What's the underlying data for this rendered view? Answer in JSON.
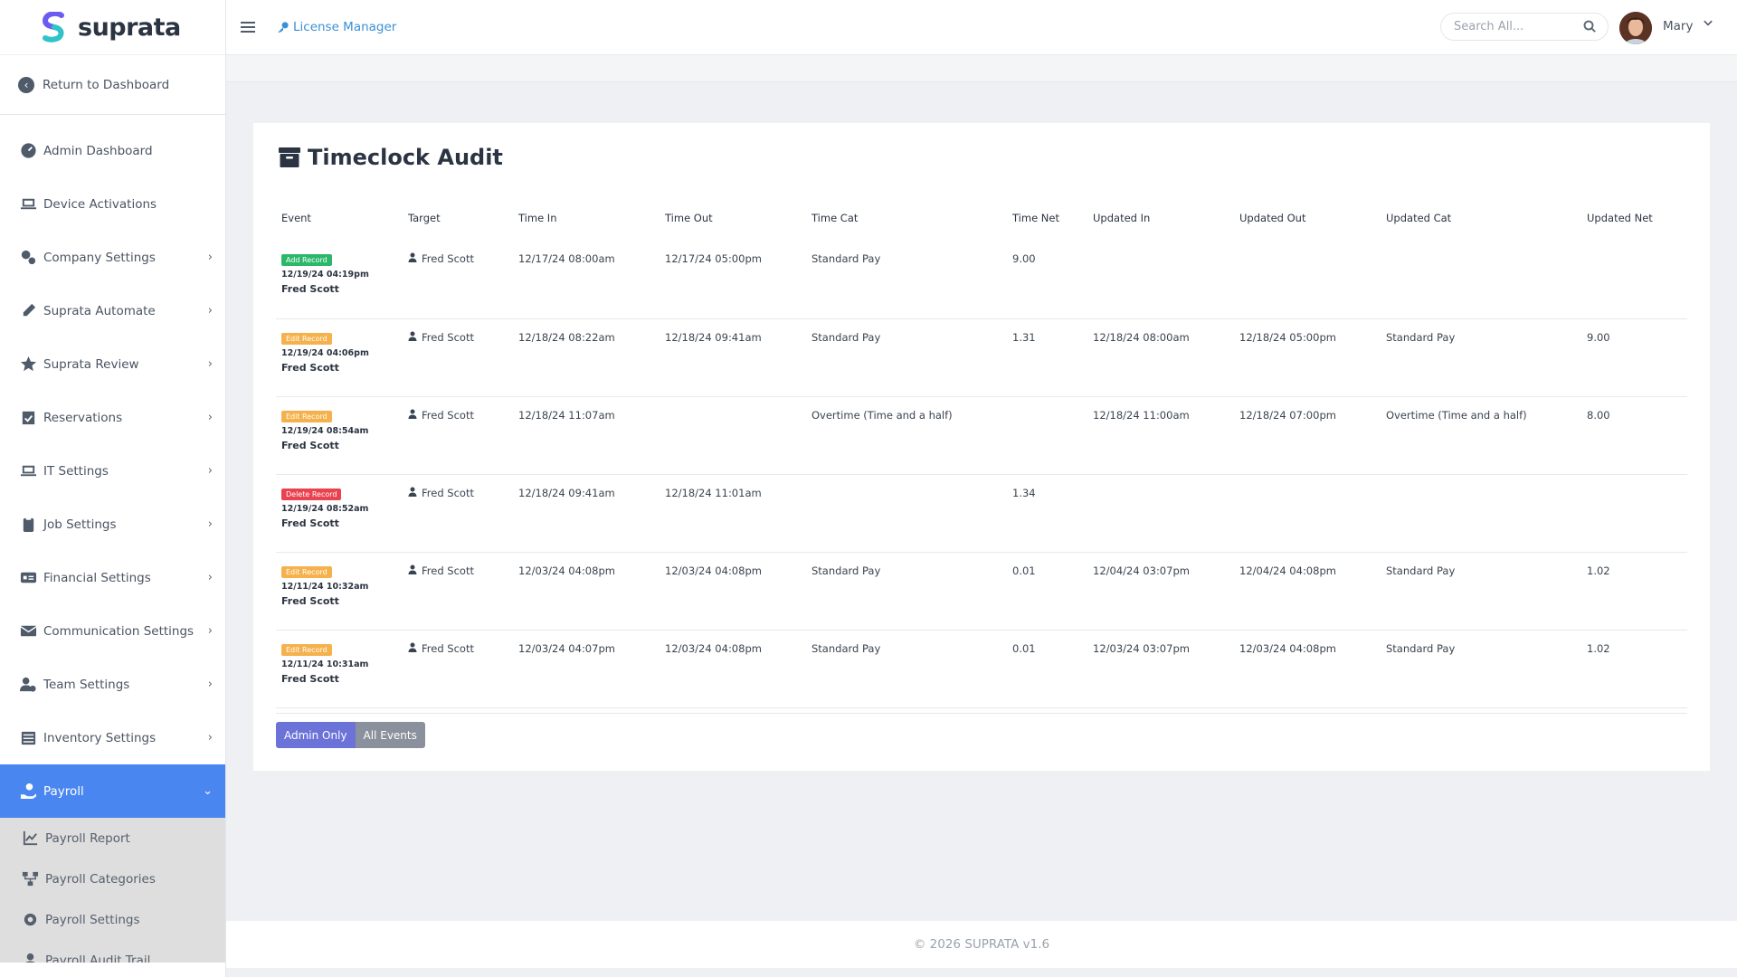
{
  "brand": {
    "name": "suprata"
  },
  "sidebar": {
    "return_label": "Return to Dashboard",
    "items": [
      {
        "label": "Admin Dashboard",
        "icon": "gauge-icon",
        "chevron": false
      },
      {
        "label": "Device Activations",
        "icon": "laptop-icon",
        "chevron": false
      },
      {
        "label": "Company Settings",
        "icon": "gears-icon",
        "chevron": true
      },
      {
        "label": "Suprata Automate",
        "icon": "pen-icon",
        "chevron": true
      },
      {
        "label": "Suprata Review",
        "icon": "star-icon",
        "chevron": true
      },
      {
        "label": "Reservations",
        "icon": "calendar-check-icon",
        "chevron": true
      },
      {
        "label": "IT Settings",
        "icon": "laptop-icon",
        "chevron": true
      },
      {
        "label": "Job Settings",
        "icon": "clipboard-icon",
        "chevron": true
      },
      {
        "label": "Financial Settings",
        "icon": "id-card-icon",
        "chevron": true
      },
      {
        "label": "Communication Settings",
        "icon": "envelope-icon",
        "chevron": true
      },
      {
        "label": "Team Settings",
        "icon": "users-cog-icon",
        "chevron": true
      },
      {
        "label": "Inventory Settings",
        "icon": "list-icon",
        "chevron": true
      }
    ],
    "active": {
      "label": "Payroll",
      "icon": "hand-holding-dollar-icon"
    },
    "sub_items": [
      {
        "label": "Payroll Report",
        "icon": "line-chart-icon"
      },
      {
        "label": "Payroll Categories",
        "icon": "sitemap-icon"
      },
      {
        "label": "Payroll Settings",
        "icon": "gear-icon"
      },
      {
        "label": "Payroll Audit Trail",
        "icon": "user-icon"
      }
    ]
  },
  "topbar": {
    "breadcrumb": "License Manager",
    "search_placeholder": "Search All...",
    "user_name": "Mary"
  },
  "card": {
    "title": "Timeclock Audit",
    "columns": [
      "Event",
      "Target",
      "Time In",
      "Time Out",
      "Time Cat",
      "Time Net",
      "Updated In",
      "Updated Out",
      "Updated Cat",
      "Updated Net"
    ],
    "rows": [
      {
        "badge": "Add Record",
        "badge_type": "add",
        "event_time": "12/19/24 04:19pm",
        "event_user": "Fred Scott",
        "target": "Fred Scott",
        "time_in": "12/17/24 08:00am",
        "time_out": "12/17/24 05:00pm",
        "time_cat": "Standard Pay",
        "time_net": "9.00",
        "updated_in": "",
        "updated_out": "",
        "updated_cat": "",
        "updated_net": ""
      },
      {
        "badge": "Edit Record",
        "badge_type": "edit",
        "event_time": "12/19/24 04:06pm",
        "event_user": "Fred Scott",
        "target": "Fred Scott",
        "time_in": "12/18/24 08:22am",
        "time_out": "12/18/24 09:41am",
        "time_cat": "Standard Pay",
        "time_net": "1.31",
        "updated_in": "12/18/24 08:00am",
        "updated_out": "12/18/24 05:00pm",
        "updated_cat": "Standard Pay",
        "updated_net": "9.00"
      },
      {
        "badge": "Edit Record",
        "badge_type": "edit",
        "event_time": "12/19/24 08:54am",
        "event_user": "Fred Scott",
        "target": "Fred Scott",
        "time_in": "12/18/24 11:07am",
        "time_out": "",
        "time_cat": "Overtime (Time and a half)",
        "time_net": "",
        "updated_in": "12/18/24 11:00am",
        "updated_out": "12/18/24 07:00pm",
        "updated_cat": "Overtime (Time and a half)",
        "updated_net": "8.00"
      },
      {
        "badge": "Delete Record",
        "badge_type": "delete",
        "event_time": "12/19/24 08:52am",
        "event_user": "Fred Scott",
        "target": "Fred Scott",
        "time_in": "12/18/24 09:41am",
        "time_out": "12/18/24 11:01am",
        "time_cat": "",
        "time_net": "1.34",
        "updated_in": "",
        "updated_out": "",
        "updated_cat": "",
        "updated_net": ""
      },
      {
        "badge": "Edit Record",
        "badge_type": "edit",
        "event_time": "12/11/24 10:32am",
        "event_user": "Fred Scott",
        "target": "Fred Scott",
        "time_in": "12/03/24 04:08pm",
        "time_out": "12/03/24 04:08pm",
        "time_cat": "Standard Pay",
        "time_net": "0.01",
        "updated_in": "12/04/24 03:07pm",
        "updated_out": "12/04/24 04:08pm",
        "updated_cat": "Standard Pay",
        "updated_net": "1.02"
      },
      {
        "badge": "Edit Record",
        "badge_type": "edit",
        "event_time": "12/11/24 10:31am",
        "event_user": "Fred Scott",
        "target": "Fred Scott",
        "time_in": "12/03/24 04:07pm",
        "time_out": "12/03/24 04:08pm",
        "time_cat": "Standard Pay",
        "time_net": "0.01",
        "updated_in": "12/03/24 03:07pm",
        "updated_out": "12/03/24 04:08pm",
        "updated_cat": "Standard Pay",
        "updated_net": "1.02"
      }
    ],
    "buttons": {
      "admin_only": "Admin Only",
      "all_events": "All Events"
    }
  },
  "footer": {
    "text": "© 2026 SUPRATA v1.6"
  },
  "colors": {
    "accent": "#4a86f0",
    "add": "#2cb86a",
    "edit": "#f5b14c",
    "delete": "#e8434f",
    "btn_primary": "#6b72d8",
    "btn_secondary": "#8a919c"
  }
}
